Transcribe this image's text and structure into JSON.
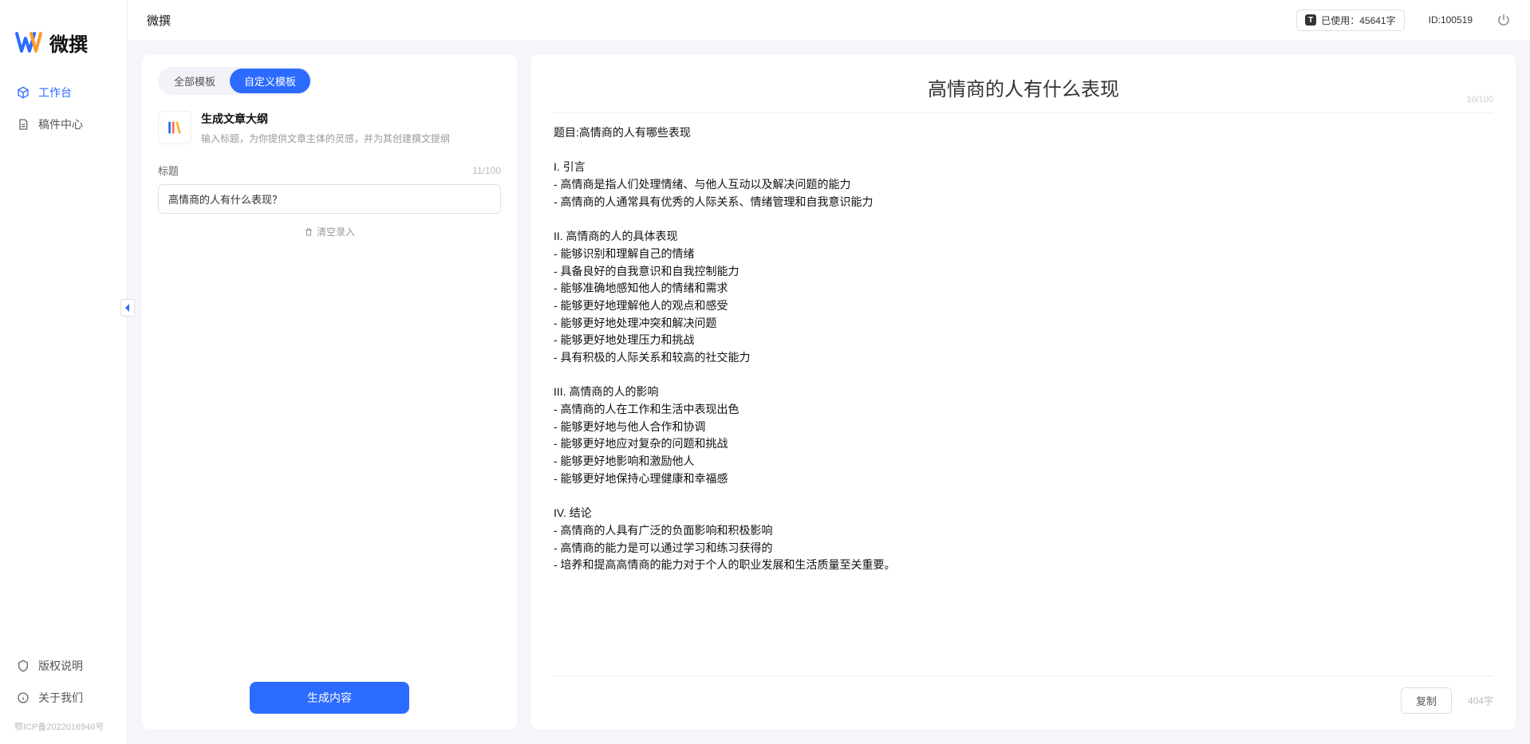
{
  "app_name": "微撰",
  "logo_text": "微撰",
  "sidebar": {
    "items": [
      {
        "label": "工作台",
        "icon": "cube-icon",
        "active": true
      },
      {
        "label": "稿件中心",
        "icon": "doc-icon",
        "active": false
      }
    ],
    "bottom": [
      {
        "label": "版权说明",
        "icon": "shield-icon"
      },
      {
        "label": "关于我们",
        "icon": "info-icon"
      }
    ],
    "icp": "鄂ICP备2022016946号"
  },
  "topbar": {
    "title": "微撰",
    "usage_prefix": "已使用：",
    "usage_value": "45641字",
    "user_id": "ID:100519"
  },
  "left": {
    "tabs": [
      {
        "label": "全部模板",
        "active": false
      },
      {
        "label": "自定义模板",
        "active": true
      }
    ],
    "template": {
      "title": "生成文章大纲",
      "desc": "输入标题，为你提供文章主体的灵感，并为其创建撰文提纲"
    },
    "field_label": "标题",
    "field_counter": "11/100",
    "title_value": "高情商的人有什么表现？",
    "clear_label": "清空录入",
    "generate_label": "生成内容"
  },
  "right": {
    "title": "高情商的人有什么表现",
    "title_counter": "10/100",
    "body": "题目:高情商的人有哪些表现\n\nI. 引言\n- 高情商是指人们处理情绪、与他人互动以及解决问题的能力\n- 高情商的人通常具有优秀的人际关系、情绪管理和自我意识能力\n\nII. 高情商的人的具体表现\n- 能够识别和理解自己的情绪\n- 具备良好的自我意识和自我控制能力\n- 能够准确地感知他人的情绪和需求\n- 能够更好地理解他人的观点和感受\n- 能够更好地处理冲突和解决问题\n- 能够更好地处理压力和挑战\n- 具有积极的人际关系和较高的社交能力\n\nIII. 高情商的人的影响\n- 高情商的人在工作和生活中表现出色\n- 能够更好地与他人合作和协调\n- 能够更好地应对复杂的问题和挑战\n- 能够更好地影响和激励他人\n- 能够更好地保持心理健康和幸福感\n\nIV. 结论\n- 高情商的人具有广泛的负面影响和积极影响\n- 高情商的能力是可以通过学习和练习获得的\n- 培养和提高高情商的能力对于个人的职业发展和生活质量至关重要。",
    "copy_label": "复制",
    "word_count": "404字"
  }
}
